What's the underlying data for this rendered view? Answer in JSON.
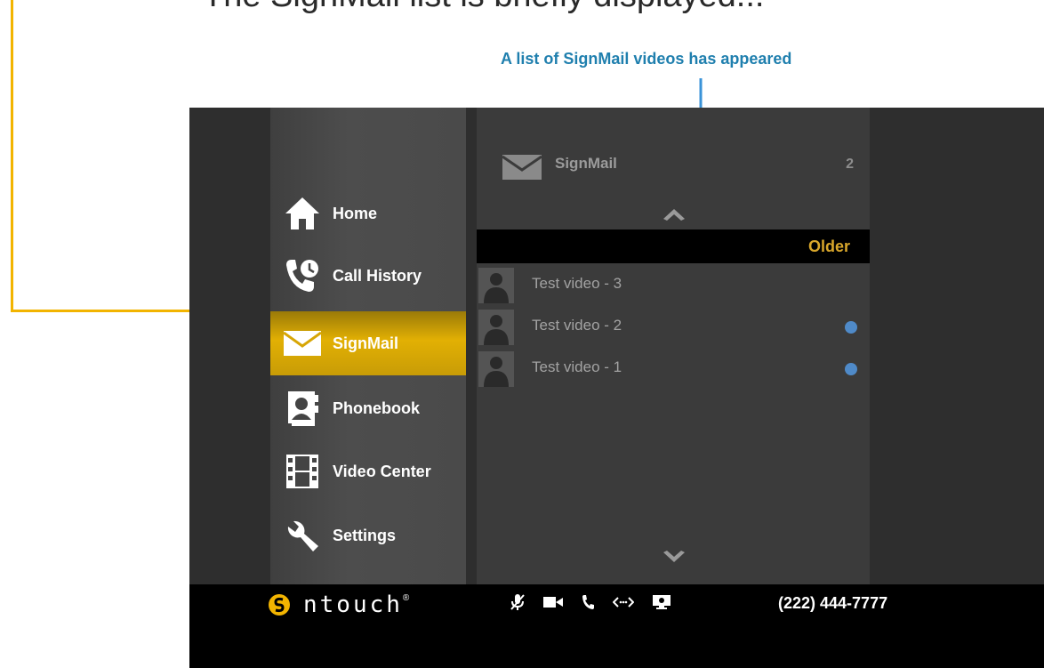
{
  "top_caption": "The SignMail list is briefly displayed...",
  "callout_blue": "A list of SignMail videos has appeared",
  "nav": {
    "items": [
      {
        "label": "Home",
        "icon": "home-icon",
        "active": false
      },
      {
        "label": "Call History",
        "icon": "call-history-icon",
        "active": false
      },
      {
        "label": "SignMail",
        "icon": "envelope-icon",
        "active": true
      },
      {
        "label": "Phonebook",
        "icon": "phonebook-icon",
        "active": false
      },
      {
        "label": "Video Center",
        "icon": "film-icon",
        "active": false
      },
      {
        "label": "Settings",
        "icon": "wrench-icon",
        "active": false
      }
    ]
  },
  "panel": {
    "title": "SignMail",
    "count": "2",
    "older_label": "Older",
    "videos": [
      {
        "title": "Test video - 3",
        "unread": false
      },
      {
        "title": "Test video - 2",
        "unread": true
      },
      {
        "title": "Test video - 1",
        "unread": true
      }
    ]
  },
  "status_bar": {
    "brand": "ntouch",
    "brand_mark": "®",
    "phone_number": "(222) 444-7777",
    "icons": [
      "mic-muted-icon",
      "video-camera-icon",
      "phone-icon",
      "connection-icon",
      "screen-share-icon"
    ]
  },
  "colors": {
    "accent_gold": "#e2b004",
    "callout_blue": "#1f7fae",
    "callout_yellow": "#f2b400",
    "unread_dot": "#4f8ac8",
    "older_text": "#d9a72b"
  }
}
